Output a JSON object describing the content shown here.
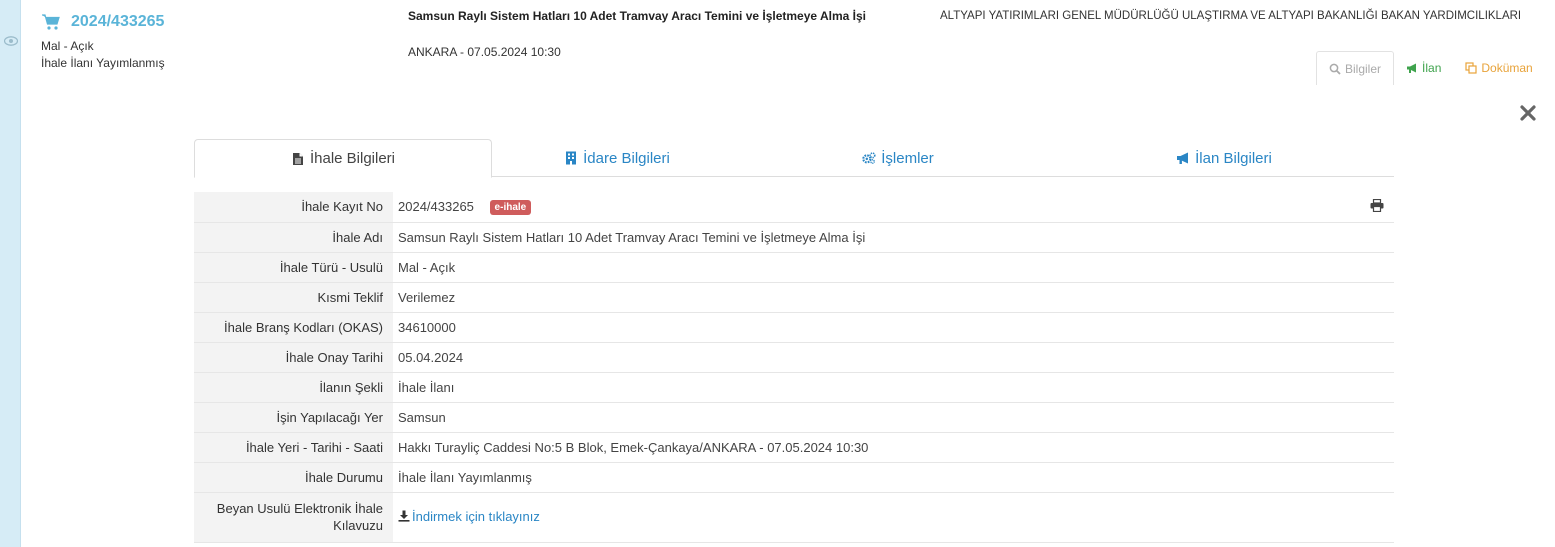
{
  "header": {
    "ikn": "2024/433265",
    "type": "Mal - Açık",
    "status": "İhale İlanı Yayımlanmış",
    "title": "Samsun Raylı Sistem Hatları 10 Adet Tramvay Aracı Temini ve İşletmeye Alma İşi",
    "place_date": "ANKARA - 07.05.2024 10:30",
    "authority": "ALTYAPI YATIRIMLARI GENEL MÜDÜRLÜĞÜ ULAŞTIRMA VE ALTYAPI BAKANLIĞI BAKAN YARDIMCILIKLARI"
  },
  "actions": {
    "bilgiler": "Bilgiler",
    "ilan": "İlan",
    "dokuman": "Doküman"
  },
  "tabs": [
    {
      "label": "İhale Bilgileri",
      "icon": "file-icon"
    },
    {
      "label": "İdare Bilgileri",
      "icon": "building-icon"
    },
    {
      "label": "İşlemler",
      "icon": "gears-icon"
    },
    {
      "label": "İlan Bilgileri",
      "icon": "bullhorn-icon"
    }
  ],
  "details": {
    "rows": [
      {
        "label": "İhale Kayıt No",
        "value": "2024/433265",
        "badge": "e-ihale"
      },
      {
        "label": "İhale Adı",
        "value": "Samsun Raylı Sistem Hatları 10 Adet Tramvay Aracı Temini ve İşletmeye Alma İşi"
      },
      {
        "label": "İhale Türü - Usulü",
        "value": "Mal - Açık"
      },
      {
        "label": "Kısmi Teklif",
        "value": "Verilemez"
      },
      {
        "label": "İhale Branş Kodları (OKAS)",
        "value": "34610000"
      },
      {
        "label": "İhale Onay Tarihi",
        "value": "05.04.2024"
      },
      {
        "label": "İlanın Şekli",
        "value": "İhale İlanı"
      },
      {
        "label": "İşin Yapılacağı Yer",
        "value": "Samsun"
      },
      {
        "label": "İhale Yeri - Tarihi - Saati",
        "value": "Hakkı Turayliç Caddesi No:5 B Blok, Emek-Çankaya/ANKARA - 07.05.2024 10:30"
      },
      {
        "label": "İhale Durumu",
        "value": "İhale İlanı Yayımlanmış"
      },
      {
        "label": "Beyan Usulü Elektronik İhale Kılavuzu",
        "value": "İndirmek için tıklayınız"
      }
    ]
  },
  "colors": {
    "accent": "#2a86c5",
    "ikn": "#5ab4d8",
    "badge": "#cf5c5c",
    "ilan": "#3fa34d",
    "dokuman": "#e8a33a"
  }
}
